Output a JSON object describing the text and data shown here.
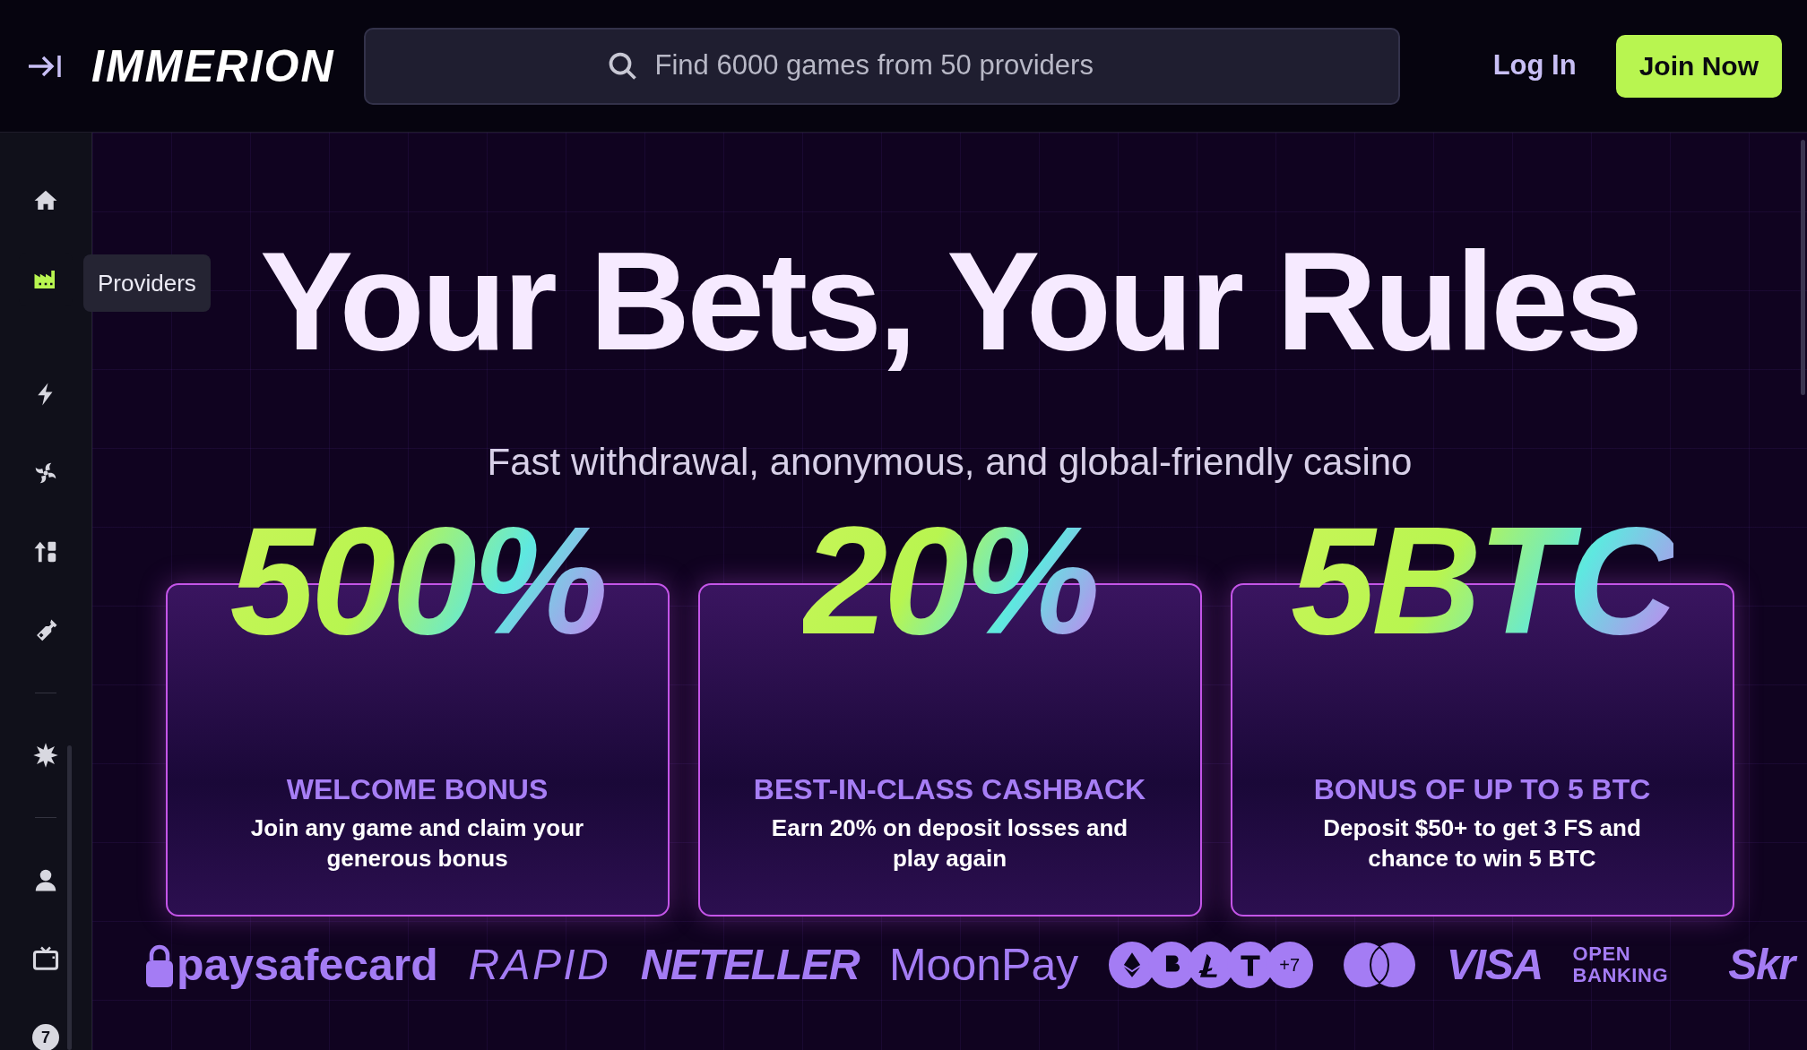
{
  "header": {
    "logo": "IMMERION",
    "search": {
      "placeholder": "Find 6000 games from 50 providers"
    },
    "login": "Log In",
    "join": "Join Now"
  },
  "sidebar": {
    "groups": [
      [
        {
          "selected": false
        },
        {
          "selected": true,
          "tooltip": "Providers"
        }
      ],
      [
        {
          "selected": false
        },
        {
          "selected": false
        },
        {
          "selected": false
        },
        {
          "selected": false
        }
      ],
      [
        {
          "selected": false
        }
      ],
      [
        {
          "selected": false
        },
        {
          "selected": false
        },
        {
          "selected": false,
          "text": "7"
        }
      ]
    ]
  },
  "hero": {
    "title": "Your Bets, Your Rules",
    "subtitle": "Fast withdrawal, anonymous, and global-friendly casino"
  },
  "cards": [
    {
      "big": "500%",
      "heading": "WELCOME BONUS",
      "body": "Join any game and claim your generous bonus"
    },
    {
      "big": "20%",
      "heading": "BEST-IN-CLASS CASHBACK",
      "body": "Earn 20% on deposit losses and play again"
    },
    {
      "big": "5BTC",
      "heading": "BONUS OF UP TO 5 BTC",
      "body": "Deposit $50+ to get 3 FS and chance to win 5 BTC"
    }
  ],
  "payments": [
    {
      "kind": "paysafe",
      "text": "paysafecard"
    },
    {
      "kind": "italic",
      "text": "RAPID"
    },
    {
      "kind": "heavy",
      "text": "NETELLER"
    },
    {
      "kind": "plain",
      "text": "MoonPay"
    },
    {
      "kind": "crypto",
      "text": "+7"
    },
    {
      "kind": "mastercard"
    },
    {
      "kind": "heavy",
      "text": "VISA"
    },
    {
      "kind": "stacked",
      "text": "OPEN BANKING"
    },
    {
      "kind": "heavy",
      "text": "Skr"
    }
  ]
}
